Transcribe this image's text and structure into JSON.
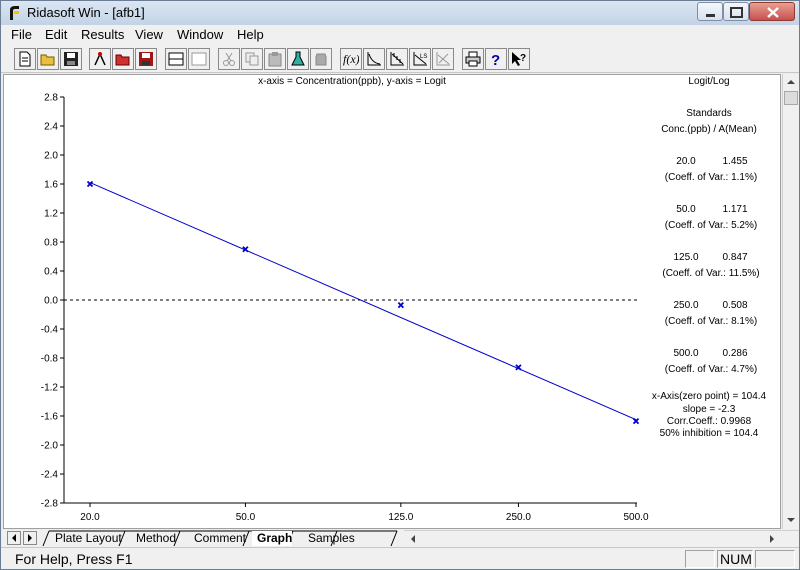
{
  "window": {
    "title": "Ridasoft Win - [afb1]"
  },
  "menu": [
    "File",
    "Edit",
    "Results",
    "View",
    "Window",
    "Help"
  ],
  "toolbar": [
    "new-document-icon",
    "open-folder-icon",
    "save-icon",
    "run-icon",
    "open-red-icon",
    "save-red-icon",
    "split-horizontal-icon",
    "split-blank-icon",
    "cut-icon",
    "copy-icon",
    "paste-icon",
    "flask-icon",
    "jar-icon",
    "function-icon",
    "curve-icon",
    "curve-points-icon",
    "curve-ls-icon",
    "curve-cross-icon",
    "print-icon",
    "help-icon",
    "context-help-icon"
  ],
  "graph": {
    "axis_title": "x-axis = Concentration(ppb), y-axis = Logit",
    "panel_title": "Logit/Log",
    "standards_heading": "Standards",
    "standards_subheading": "Conc.(ppb) / A(Mean)",
    "standards": [
      {
        "conc": "20.0",
        "mean": "1.455",
        "cv": "(Coeff. of Var.: 1.1%)"
      },
      {
        "conc": "50.0",
        "mean": "1.171",
        "cv": "(Coeff. of Var.: 5.2%)"
      },
      {
        "conc": "125.0",
        "mean": "0.847",
        "cv": "(Coeff. of Var.: 11.5%)"
      },
      {
        "conc": "250.0",
        "mean": "0.508",
        "cv": "(Coeff. of Var.: 8.1%)"
      },
      {
        "conc": "500.0",
        "mean": "0.286",
        "cv": "(Coeff. of Var.: 4.7%)"
      }
    ],
    "stats": [
      "x-Axis(zero point) = 104.4",
      "slope = -2.3",
      "Corr.Coeff.: 0.9968",
      "50% inhibition = 104.4"
    ]
  },
  "chart_data": {
    "type": "line",
    "title": "x-axis = Concentration(ppb), y-axis = Logit",
    "xlabel": "Concentration(ppb)",
    "ylabel": "Logit",
    "x_scale": "log",
    "x_ticks": [
      "20.0",
      "50.0",
      "125.0",
      "250.0",
      "500.0"
    ],
    "y_ticks": [
      "2.8",
      "2.4",
      "2.0",
      "1.6",
      "1.2",
      "0.8",
      "0.4",
      "0.0",
      "-0.4",
      "-0.8",
      "-1.2",
      "-1.6",
      "-2.0",
      "-2.4",
      "-2.8"
    ],
    "ylim": [
      -2.8,
      2.8
    ],
    "xlim": [
      20,
      500
    ],
    "points": [
      {
        "x": 20,
        "y": 1.6
      },
      {
        "x": 50,
        "y": 0.7
      },
      {
        "x": 125,
        "y": -0.07
      },
      {
        "x": 250,
        "y": -0.93
      },
      {
        "x": 500,
        "y": -1.67
      }
    ],
    "fit_line": [
      {
        "x": 20,
        "y": 1.62
      },
      {
        "x": 500,
        "y": -1.65
      }
    ],
    "zero_line": {
      "y": 0,
      "style": "dashed"
    },
    "series_color": "#0000cc"
  },
  "tabs": {
    "items": [
      "Plate Layout",
      "Method",
      "Comment",
      "Graph",
      "Samples"
    ],
    "active": "Graph"
  },
  "status": {
    "text": "For Help, Press F1",
    "num": "NUM"
  }
}
